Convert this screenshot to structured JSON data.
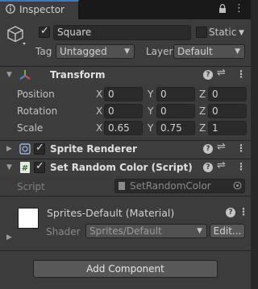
{
  "tab": {
    "title": "Inspector",
    "lock_icon": "lock-icon",
    "menu_icon": "kebab-menu-icon"
  },
  "gameobject": {
    "active": true,
    "name": "Square",
    "static_label": "Static",
    "static_checked": false,
    "tag_label": "Tag",
    "tag_value": "Untagged",
    "layer_label": "Layer",
    "layer_value": "Default"
  },
  "transform": {
    "title": "Transform",
    "position_label": "Position",
    "rotation_label": "Rotation",
    "scale_label": "Scale",
    "axis_x": "X",
    "axis_y": "Y",
    "axis_z": "Z",
    "position": {
      "x": "0",
      "y": "0",
      "z": "0"
    },
    "rotation": {
      "x": "0",
      "y": "0",
      "z": "0"
    },
    "scale": {
      "x": "0.65",
      "y": "0.75",
      "z": "1"
    }
  },
  "sprite_renderer": {
    "title": "Sprite Renderer",
    "enabled": true
  },
  "script_component": {
    "title": "Set Random Color (Script)",
    "enabled": true,
    "script_label": "Script",
    "script_value": "SetRandomColor"
  },
  "material": {
    "title": "Sprites-Default (Material)",
    "shader_label": "Shader",
    "shader_value": "Sprites/Default",
    "edit_label": "Edit...",
    "swatch_color": "#ffffff"
  },
  "add_component_label": "Add Component",
  "colors": {
    "accent": "#3a79bb",
    "panel": "#3c3c3c",
    "field": "#2a2a2a"
  }
}
